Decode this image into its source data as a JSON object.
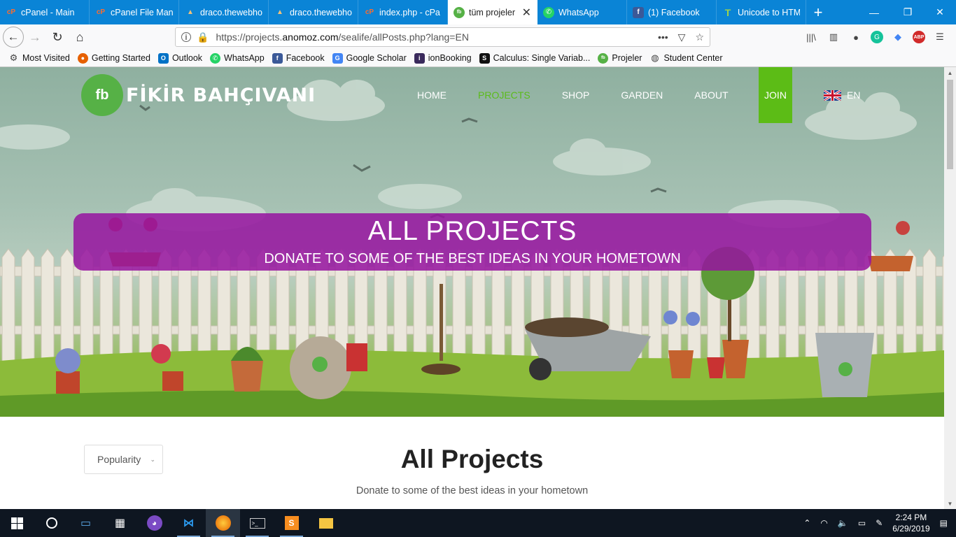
{
  "browser": {
    "tabs": [
      {
        "title": "cPanel - Main",
        "icon": "cpanel-icon",
        "active": false
      },
      {
        "title": "cPanel File Mana",
        "icon": "cpanel-icon",
        "active": false
      },
      {
        "title": "draco.thewebho",
        "icon": "server-icon",
        "active": false
      },
      {
        "title": "draco.thewebho",
        "icon": "server-icon",
        "active": false
      },
      {
        "title": "index.php - cPa",
        "icon": "cpanel-icon",
        "active": false
      },
      {
        "title": "tüm projeler",
        "icon": "fb-leaf-icon",
        "active": true
      },
      {
        "title": "WhatsApp",
        "icon": "whatsapp-icon",
        "active": false
      },
      {
        "title": "(1) Facebook",
        "icon": "facebook-icon",
        "active": false
      },
      {
        "title": "Unicode to HTM",
        "icon": "t-icon",
        "active": false
      }
    ],
    "url_prefix": "https://projects.",
    "url_domain": "anomoz.com",
    "url_path": "/sealife/allPosts.php?lang=EN",
    "bookmarks": [
      {
        "label": "Most Visited",
        "icon": "gear-icon"
      },
      {
        "label": "Getting Started",
        "icon": "firefox-icon"
      },
      {
        "label": "Outlook",
        "icon": "outlook-icon"
      },
      {
        "label": "WhatsApp",
        "icon": "whatsapp-icon"
      },
      {
        "label": "Facebook",
        "icon": "facebook-icon"
      },
      {
        "label": "Google Scholar",
        "icon": "scholar-icon"
      },
      {
        "label": "ionBooking",
        "icon": "ion-icon"
      },
      {
        "label": "Calculus: Single Variab...",
        "icon": "s-icon"
      },
      {
        "label": "Projeler",
        "icon": "fb-leaf-icon"
      },
      {
        "label": "Student Center",
        "icon": "globe-icon"
      }
    ]
  },
  "site": {
    "logo_mark": "fb",
    "logo_text": "FİKİR BAHÇIVANI",
    "nav": [
      {
        "label": "HOME",
        "active": false
      },
      {
        "label": "PROJECTS",
        "active": true
      },
      {
        "label": "SHOP",
        "active": false
      },
      {
        "label": "GARDEN",
        "active": false
      },
      {
        "label": "ABOUT",
        "active": false
      }
    ],
    "join_label": "JOIN",
    "lang_label": "EN",
    "banner_title": "ALL PROJECTS",
    "banner_subtitle": "DONATE TO SOME OF THE BEST IDEAS IN YOUR HOMETOWN",
    "sort_value": "Popularity",
    "section_title": "All Projects",
    "section_subtitle": "Donate to some of the best ideas in your hometown"
  },
  "colors": {
    "browser_blue": "#0a84d6",
    "accent_green": "#5cbc16",
    "banner_purple": "#96149f"
  },
  "taskbar": {
    "time": "2:24 PM",
    "date": "6/29/2019"
  }
}
